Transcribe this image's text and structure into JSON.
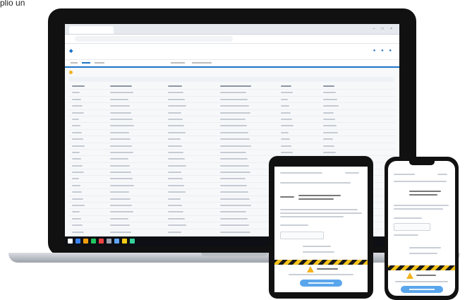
{
  "caption": "plio un"
}
